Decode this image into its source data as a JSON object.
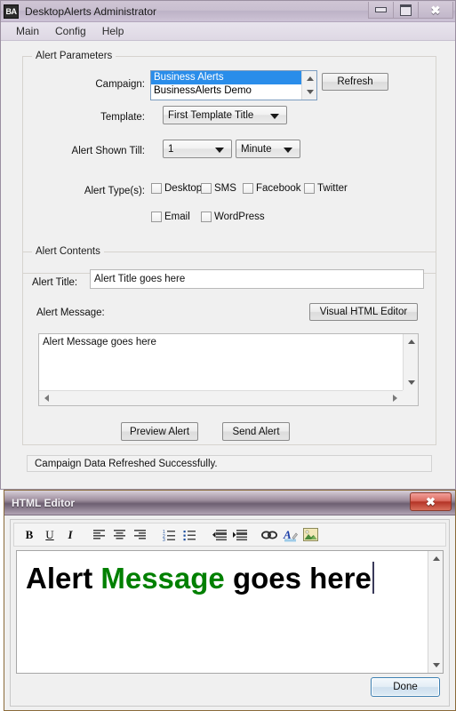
{
  "main_window": {
    "icon": "ba-app-icon",
    "title": "DesktopAlerts Administrator",
    "window_buttons": {
      "minimize": "minimize-icon",
      "maximize": "maximize-icon",
      "close": "close-icon"
    },
    "menubar": [
      {
        "label": "Main"
      },
      {
        "label": "Config"
      },
      {
        "label": "Help"
      }
    ],
    "alert_parameters": {
      "title": "Alert Parameters",
      "campaign_label": "Campaign:",
      "campaign_items": [
        {
          "label": "Business Alerts",
          "selected": true
        },
        {
          "label": "BusinessAlerts Demo",
          "selected": false
        }
      ],
      "refresh_label": "Refresh",
      "template_label": "Template:",
      "template_value": "First Template Title",
      "alert_shown_till_label": "Alert Shown Till:",
      "alert_shown_till_value": "1",
      "alert_shown_unit_value": "Minute",
      "alert_types_label": "Alert Type(s):",
      "alert_types": [
        {
          "label": "Desktop",
          "checked": false
        },
        {
          "label": "SMS",
          "checked": false
        },
        {
          "label": "Facebook",
          "checked": false
        },
        {
          "label": "Twitter",
          "checked": false
        },
        {
          "label": "Email",
          "checked": false
        },
        {
          "label": "WordPress",
          "checked": false
        }
      ]
    },
    "alert_contents": {
      "title": "Alert Contents",
      "alert_title_label": "Alert Title:",
      "alert_title_value": "Alert Title goes here",
      "alert_message_label": "Alert Message:",
      "visual_html_editor_label": "Visual HTML Editor",
      "alert_message_value": "Alert Message goes here",
      "preview_label": "Preview Alert",
      "send_label": "Send Alert"
    },
    "statusbar_text": "Campaign Data Refreshed Successfully."
  },
  "html_editor": {
    "title": "HTML Editor",
    "close_glyph": "✖",
    "toolbar": [
      {
        "name": "bold-icon",
        "glyph": "B"
      },
      {
        "name": "underline-icon",
        "glyph": "U"
      },
      {
        "name": "italic-icon",
        "glyph": "I"
      },
      {
        "name": "align-left-icon",
        "glyph": ""
      },
      {
        "name": "align-center-icon",
        "glyph": ""
      },
      {
        "name": "align-right-icon",
        "glyph": ""
      },
      {
        "name": "numbered-list-icon",
        "glyph": ""
      },
      {
        "name": "bulleted-list-icon",
        "glyph": ""
      },
      {
        "name": "outdent-icon",
        "glyph": ""
      },
      {
        "name": "indent-icon",
        "glyph": ""
      },
      {
        "name": "link-icon",
        "glyph": ""
      },
      {
        "name": "font-color-icon",
        "glyph": ""
      },
      {
        "name": "insert-image-icon",
        "glyph": ""
      }
    ],
    "content": {
      "segment_1": "Alert ",
      "segment_2": "Message",
      "segment_3": " goes here",
      "segment_2_color": "#008000",
      "segment_default_color": "#000000"
    },
    "done_label": "Done"
  }
}
